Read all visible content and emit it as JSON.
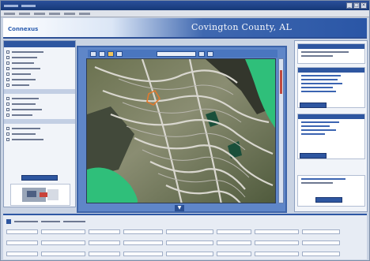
{
  "window": {
    "close_glyph": "×",
    "minimize_glyph": "_",
    "maximize_glyph": "□"
  },
  "header": {
    "title": "Covington County, AL",
    "logo_text": "Connexus"
  },
  "map": {
    "scroll_down_glyph": "▼"
  },
  "colors": {
    "brand_blue": "#2e56a0",
    "header_blue": "#2a56a6",
    "map_frame": "#5f86c8",
    "highlight_green": "#2fbf7a",
    "selection_orange": "#e07a2f"
  },
  "icons": [
    "pan-icon",
    "zoom-in-icon",
    "zoom-out-icon",
    "identify-icon",
    "measure-icon",
    "print-icon"
  ]
}
